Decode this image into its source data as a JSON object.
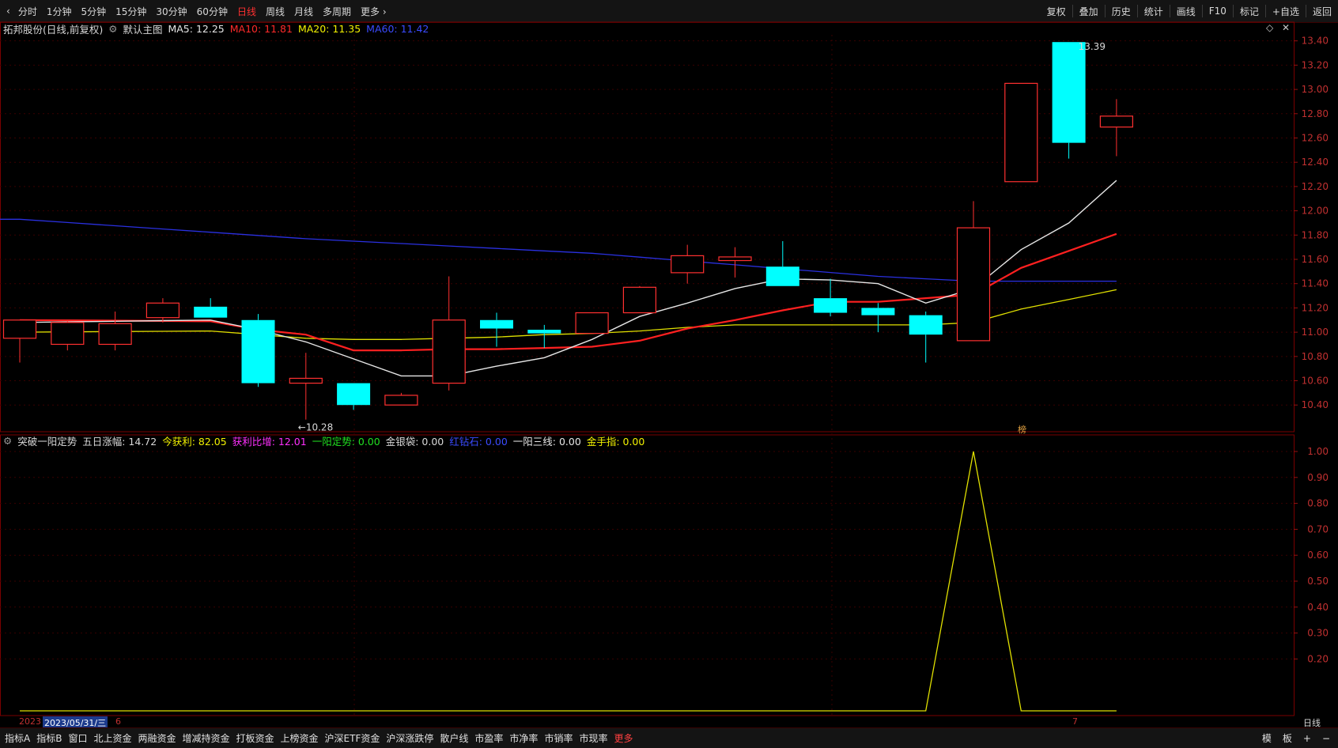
{
  "toolbar": {
    "periods": [
      "分时",
      "1分钟",
      "5分钟",
      "15分钟",
      "30分钟",
      "60分钟",
      "日线",
      "周线",
      "月线",
      "多周期",
      "更多 ›"
    ],
    "active_period": "日线",
    "right_tools": [
      "复权",
      "叠加",
      "历史",
      "统计",
      "画线",
      "F10",
      "标记",
      "+自选",
      "返回"
    ]
  },
  "main_chart": {
    "stock": "拓邦股份(日线,前复权)",
    "template": "默认主图",
    "ma": [
      {
        "label": "MA5: 12.25",
        "color": "#e6e6e6"
      },
      {
        "label": "MA10: 11.81",
        "color": "#ff2a2a"
      },
      {
        "label": "MA20: 11.35",
        "color": "#f2f200"
      },
      {
        "label": "MA60: 11.42",
        "color": "#3a4bff"
      }
    ],
    "high_marker": "13.39",
    "low_marker": "←10.28",
    "event_tag": "榜",
    "y_ticks": [
      "13.40",
      "13.20",
      "13.00",
      "12.80",
      "12.60",
      "12.40",
      "12.20",
      "12.00",
      "11.80",
      "11.60",
      "11.40",
      "11.20",
      "11.00",
      "10.80",
      "10.60",
      "10.40"
    ]
  },
  "chart_data": {
    "type": "candlestick",
    "ylim": [
      10.18,
      13.45
    ],
    "candles": [
      {
        "o": 10.95,
        "h": 11.08,
        "l": 10.75,
        "c": 11.1
      },
      {
        "o": 10.9,
        "h": 11.1,
        "l": 10.85,
        "c": 11.08
      },
      {
        "o": 10.9,
        "h": 11.17,
        "l": 10.85,
        "c": 11.07
      },
      {
        "o": 11.12,
        "h": 11.28,
        "l": 11.08,
        "c": 11.24
      },
      {
        "o": 11.21,
        "h": 11.28,
        "l": 11.12,
        "c": 11.12
      },
      {
        "o": 11.1,
        "h": 11.15,
        "l": 10.55,
        "c": 10.58
      },
      {
        "o": 10.58,
        "h": 10.83,
        "l": 10.28,
        "c": 10.62
      },
      {
        "o": 10.58,
        "h": 10.58,
        "l": 10.36,
        "c": 10.4
      },
      {
        "o": 10.4,
        "h": 10.5,
        "l": 10.4,
        "c": 10.48
      },
      {
        "o": 10.58,
        "h": 11.46,
        "l": 10.52,
        "c": 11.1
      },
      {
        "o": 11.1,
        "h": 11.16,
        "l": 10.88,
        "c": 11.03
      },
      {
        "o": 11.02,
        "h": 11.06,
        "l": 10.87,
        "c": 10.99
      },
      {
        "o": 10.99,
        "h": 11.16,
        "l": 10.99,
        "c": 11.16
      },
      {
        "o": 11.16,
        "h": 11.38,
        "l": 11.16,
        "c": 11.37
      },
      {
        "o": 11.49,
        "h": 11.72,
        "l": 11.4,
        "c": 11.63
      },
      {
        "o": 11.59,
        "h": 11.7,
        "l": 11.45,
        "c": 11.62
      },
      {
        "o": 11.54,
        "h": 11.75,
        "l": 11.38,
        "c": 11.38
      },
      {
        "o": 11.28,
        "h": 11.44,
        "l": 11.13,
        "c": 11.16
      },
      {
        "o": 11.2,
        "h": 11.24,
        "l": 11.0,
        "c": 11.14
      },
      {
        "o": 11.14,
        "h": 11.17,
        "l": 10.75,
        "c": 10.98
      },
      {
        "o": 10.93,
        "h": 12.08,
        "l": 10.93,
        "c": 11.86
      },
      {
        "o": 12.24,
        "h": 13.05,
        "l": 12.24,
        "c": 13.05
      },
      {
        "o": 13.39,
        "h": 13.39,
        "l": 12.43,
        "c": 12.56
      },
      {
        "o": 12.69,
        "h": 12.92,
        "l": 12.45,
        "c": 12.78
      }
    ],
    "ma5": [
      11.08,
      null,
      null,
      null,
      11.1,
      11.02,
      10.92,
      10.78,
      10.64,
      10.64,
      10.72,
      10.79,
      10.94,
      11.13,
      11.24,
      11.36,
      11.44,
      11.43,
      11.4,
      11.24,
      11.36,
      11.68,
      11.9,
      12.25
    ],
    "ma10": [
      11.1,
      null,
      null,
      null,
      11.09,
      11.02,
      10.98,
      10.85,
      10.85,
      10.86,
      10.86,
      10.87,
      10.88,
      10.93,
      11.03,
      11.1,
      11.18,
      11.25,
      11.25,
      11.28,
      11.31,
      11.53,
      11.67,
      11.81
    ],
    "ma20": [
      11.0,
      null,
      null,
      null,
      11.01,
      10.98,
      10.95,
      10.94,
      10.94,
      10.95,
      10.96,
      10.98,
      10.99,
      11.01,
      11.04,
      11.06,
      11.06,
      11.06,
      11.06,
      11.06,
      11.08,
      11.19,
      11.27,
      11.35
    ],
    "ma60": [
      11.93,
      null,
      null,
      null,
      null,
      null,
      11.77,
      null,
      null,
      null,
      null,
      null,
      11.65,
      null,
      null,
      null,
      null,
      null,
      11.46,
      null,
      11.42,
      null,
      null,
      11.42
    ]
  },
  "indicator": {
    "title": "突破一阳定势",
    "items": [
      {
        "label": "五日涨幅: 14.72",
        "color": "#d8d8d8"
      },
      {
        "label": "今获利: 82.05",
        "color": "#f2f200"
      },
      {
        "label": "获利比增: 12.01",
        "color": "#ff30ff"
      },
      {
        "label": "一阳定势: 0.00",
        "color": "#20e020"
      },
      {
        "label": "金银袋: 0.00",
        "color": "#d8d8d8"
      },
      {
        "label": "红钻石: 0.00",
        "color": "#3a4bff"
      },
      {
        "label": "一阳三线: 0.00",
        "color": "#e6e6e6"
      },
      {
        "label": "金手指: 0.00",
        "color": "#f2f200"
      }
    ],
    "y_ticks": [
      "1.00",
      "0.90",
      "0.80",
      "0.70",
      "0.60",
      "0.50",
      "0.40",
      "0.30",
      "0.20"
    ],
    "values": [
      0,
      0,
      0,
      0,
      0,
      0,
      0,
      0,
      0,
      0,
      0,
      0,
      0,
      0,
      0,
      0,
      0,
      0,
      0,
      0,
      1,
      0,
      0,
      0
    ]
  },
  "date_axis": {
    "year": "2023",
    "cursor_date": "2023/05/31/三",
    "tick_6": "6",
    "tick_7": "7",
    "period_label": "日线"
  },
  "bottom_tabs": [
    "指标A",
    "指标B",
    "窗口",
    "北上资金",
    "两融资金",
    "增减持资金",
    "打板资金",
    "上榜资金",
    "沪深ETF资金",
    "沪深涨跌停",
    "散户线",
    "市盈率",
    "市净率",
    "市销率",
    "市现率",
    "更多"
  ],
  "bottom_right": [
    "模",
    "板",
    "+",
    "−"
  ]
}
